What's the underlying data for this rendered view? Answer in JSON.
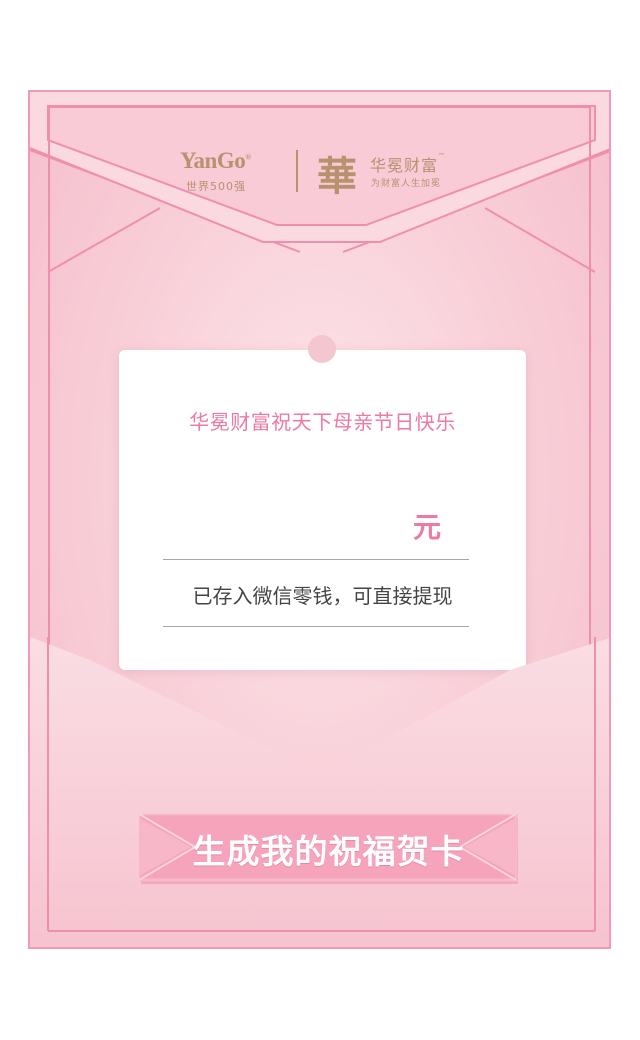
{
  "brand": {
    "yango_logo": "YanGo",
    "yango_mark": "®",
    "yango_subtitle": "世界500强",
    "hua_logo_char": "華",
    "name": "华冕财富",
    "tm": "™",
    "slogan": "为财富人生加冕"
  },
  "card": {
    "greeting": "华冕财富祝天下母亲节日快乐",
    "amount_value": "",
    "amount_unit": "元",
    "info": "已存入微信零钱，可直接提现"
  },
  "cta": {
    "label": "生成我的祝福贺卡"
  },
  "colors": {
    "pink_accent": "#ee7aa0",
    "border_pink": "#f29ab5",
    "gold": "#b8916f"
  }
}
